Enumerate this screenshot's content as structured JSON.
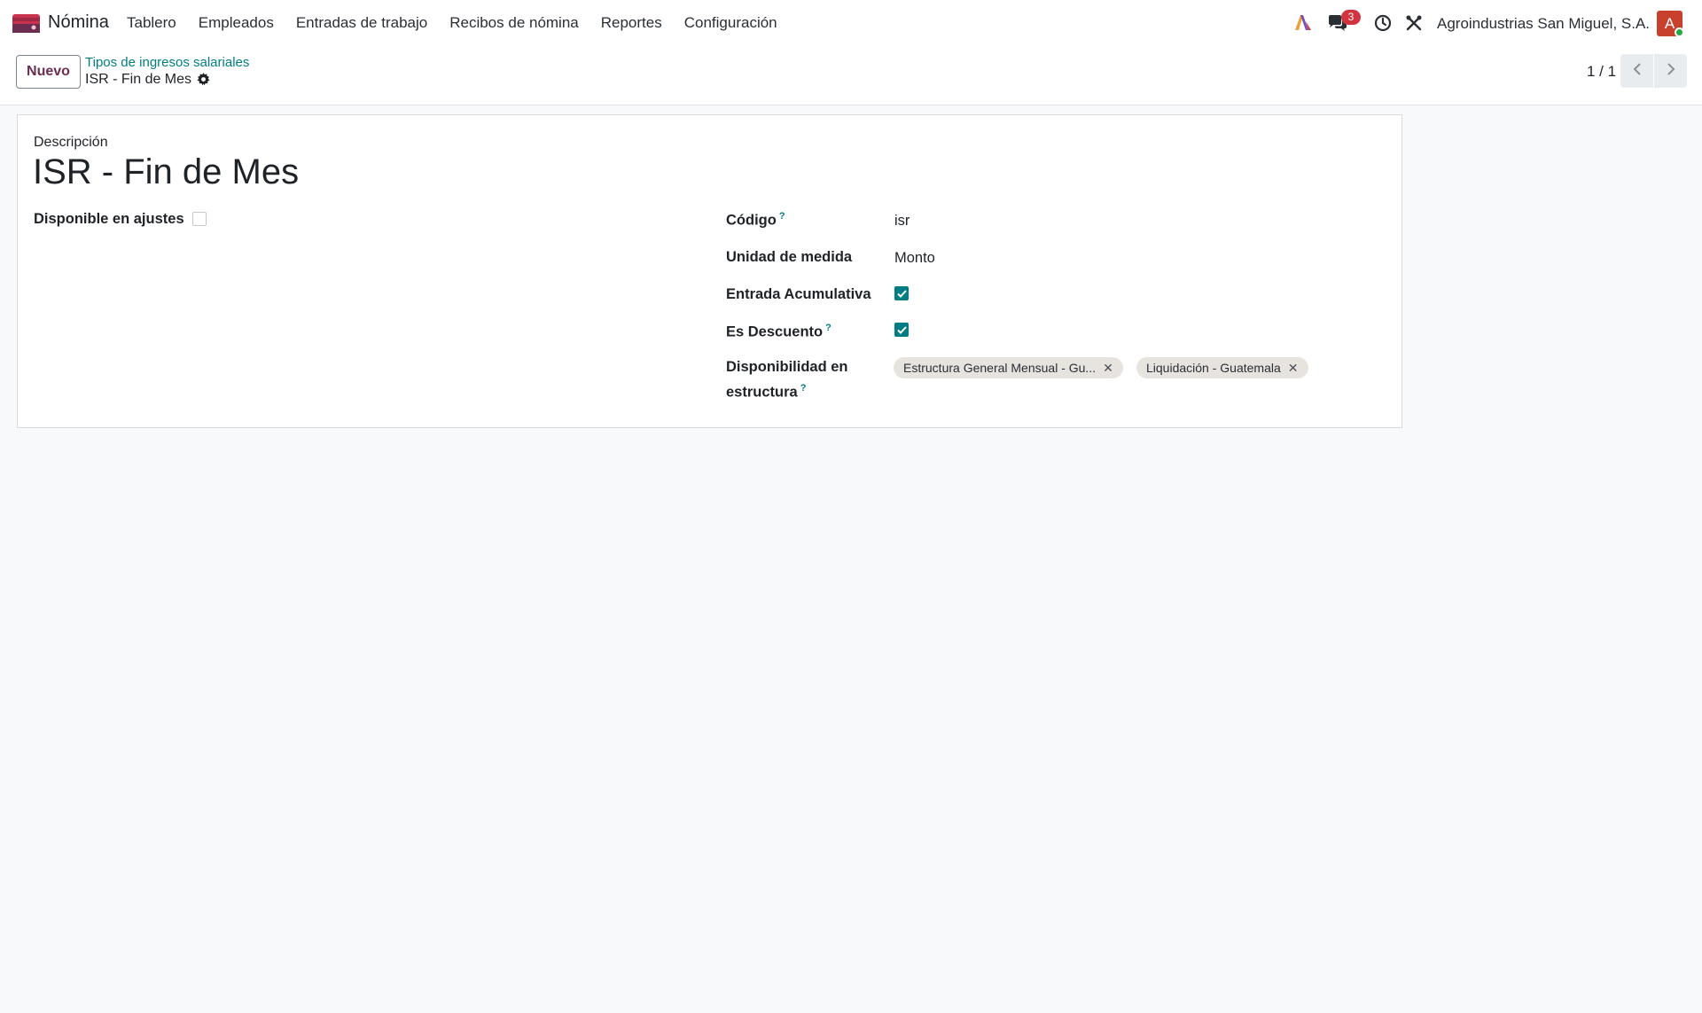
{
  "app": {
    "name": "Nómina",
    "logo_colors": [
      "#c8324d",
      "#6b2d52"
    ]
  },
  "menu": [
    {
      "label": "Tablero"
    },
    {
      "label": "Empleados"
    },
    {
      "label": "Entradas de trabajo"
    },
    {
      "label": "Recibos de nómina"
    },
    {
      "label": "Reportes"
    },
    {
      "label": "Configuración"
    }
  ],
  "systray": {
    "ai_icon": "ai-sparkle-icon",
    "chat_icon": "chat-bubbles-icon",
    "chat_badge": "3",
    "clock_icon": "clock-icon",
    "tools_icon": "tools-icon",
    "company": "Agroindustrias San Miguel, S.A.",
    "avatar_letter": "A",
    "avatar_color": "#c8412c"
  },
  "control": {
    "new_button": "Nuevo",
    "breadcrumb_parent": "Tipos de ingresos salariales",
    "breadcrumb_current": "ISR - Fin de Mes",
    "gear_icon": "gear-icon",
    "pager": "1 / 1"
  },
  "form": {
    "description_label": "Descripción",
    "title": "ISR - Fin de Mes",
    "available_in_adjustments": {
      "label": "Disponible en ajustes",
      "checked": false
    },
    "code": {
      "label": "Código",
      "help": "?",
      "value": "isr"
    },
    "unit": {
      "label": "Unidad de medida",
      "value": "Monto"
    },
    "cumulative": {
      "label": "Entrada Acumulativa",
      "checked": true
    },
    "is_discount": {
      "label": "Es Descuento",
      "help": "?",
      "checked": true
    },
    "structure_availability": {
      "label": "Disponibilidad en estructura",
      "help": "?",
      "tags": [
        "Estructura General Mensual - Gu...",
        "Liquidación - Guatemala"
      ]
    }
  },
  "colors": {
    "accent": "#017e84",
    "primary": "#6b2d52",
    "badge": "#d1343f"
  }
}
